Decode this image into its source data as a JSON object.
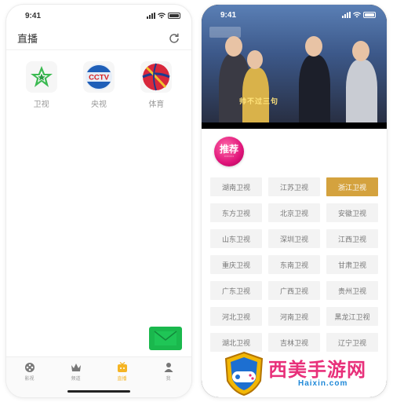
{
  "left_phone": {
    "status": {
      "time": "9:41"
    },
    "navbar": {
      "title": "直播"
    },
    "channels": [
      {
        "label": "卫视",
        "icon": "satellite-tv-icon"
      },
      {
        "label": "央视",
        "icon": "cctv-icon"
      },
      {
        "label": "体育",
        "icon": "sports-ball-icon"
      }
    ],
    "tabbar": [
      {
        "label": "影视",
        "icon": "film-reel-icon",
        "active": false
      },
      {
        "label": "频道",
        "icon": "crown-icon",
        "active": false
      },
      {
        "label": "直播",
        "icon": "live-tv-icon",
        "active": true
      },
      {
        "label": "我",
        "icon": "user-icon",
        "active": false
      }
    ],
    "accent": "#f5b423",
    "mail_button_color": "#1ab84d"
  },
  "right_phone": {
    "status": {
      "time": "9:41"
    },
    "video": {
      "caption": "帅不过三句"
    },
    "badge": {
      "title": "推荐",
      "sub": "• • • • •"
    },
    "selected_color": "#d4a23e",
    "stations": [
      "湖南卫视",
      "江苏卫视",
      "浙江卫视",
      "东方卫视",
      "北京卫视",
      "安徽卫视",
      "山东卫视",
      "深圳卫视",
      "江西卫视",
      "重庆卫视",
      "东南卫视",
      "甘肃卫视",
      "广东卫视",
      "广西卫视",
      "贵州卫视",
      "河北卫视",
      "河南卫视",
      "黑龙江卫视",
      "湖北卫视",
      "吉林卫视",
      "辽宁卫视"
    ],
    "selected_station": "浙江卫视"
  },
  "watermark": {
    "text": "西美手游网",
    "url": "Haixin.com"
  }
}
